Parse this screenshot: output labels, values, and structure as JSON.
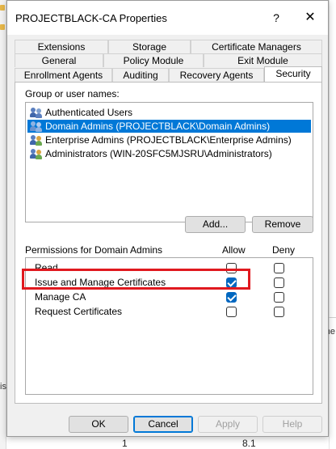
{
  "window": {
    "title": "PROJECTBLACK-CA Properties",
    "help_glyph": "?",
    "close_glyph": "✕"
  },
  "tabs": {
    "row1": [
      "Extensions",
      "Storage",
      "Certificate Managers"
    ],
    "row2": [
      "General",
      "Policy Module",
      "Exit Module"
    ],
    "row3": [
      "Enrollment Agents",
      "Auditing",
      "Recovery Agents",
      "Security"
    ],
    "active": "Security"
  },
  "security": {
    "group_label": "Group or user names:",
    "users": [
      {
        "name": "Authenticated Users",
        "selected": false
      },
      {
        "name": "Domain Admins (PROJECTBLACK\\Domain Admins)",
        "selected": true
      },
      {
        "name": "Enterprise Admins (PROJECTBLACK\\Enterprise Admins)",
        "selected": false
      },
      {
        "name": "Administrators (WIN-20SFC5MJSRU\\Administrators)",
        "selected": false
      }
    ],
    "add_label": "Add...",
    "remove_label": "Remove",
    "permissions_label": "Permissions for Domain Admins",
    "allow_label": "Allow",
    "deny_label": "Deny",
    "permissions": [
      {
        "name": "Read",
        "allow": false,
        "deny": false
      },
      {
        "name": "Issue and Manage Certificates",
        "allow": true,
        "deny": false
      },
      {
        "name": "Manage CA",
        "allow": true,
        "deny": false
      },
      {
        "name": "Request Certificates",
        "allow": false,
        "deny": false
      }
    ]
  },
  "buttons": {
    "ok": "OK",
    "cancel": "Cancel",
    "apply": "Apply",
    "help": "Help"
  },
  "background": {
    "bottom_values": [
      "1",
      "8.1"
    ],
    "left_fragment": "is",
    "right_fragment": "he"
  },
  "colors": {
    "selection": "#0078d7",
    "checkbox": "#0067c0",
    "highlight": "#e0191f",
    "dialog_bg": "#f0f0f0"
  }
}
